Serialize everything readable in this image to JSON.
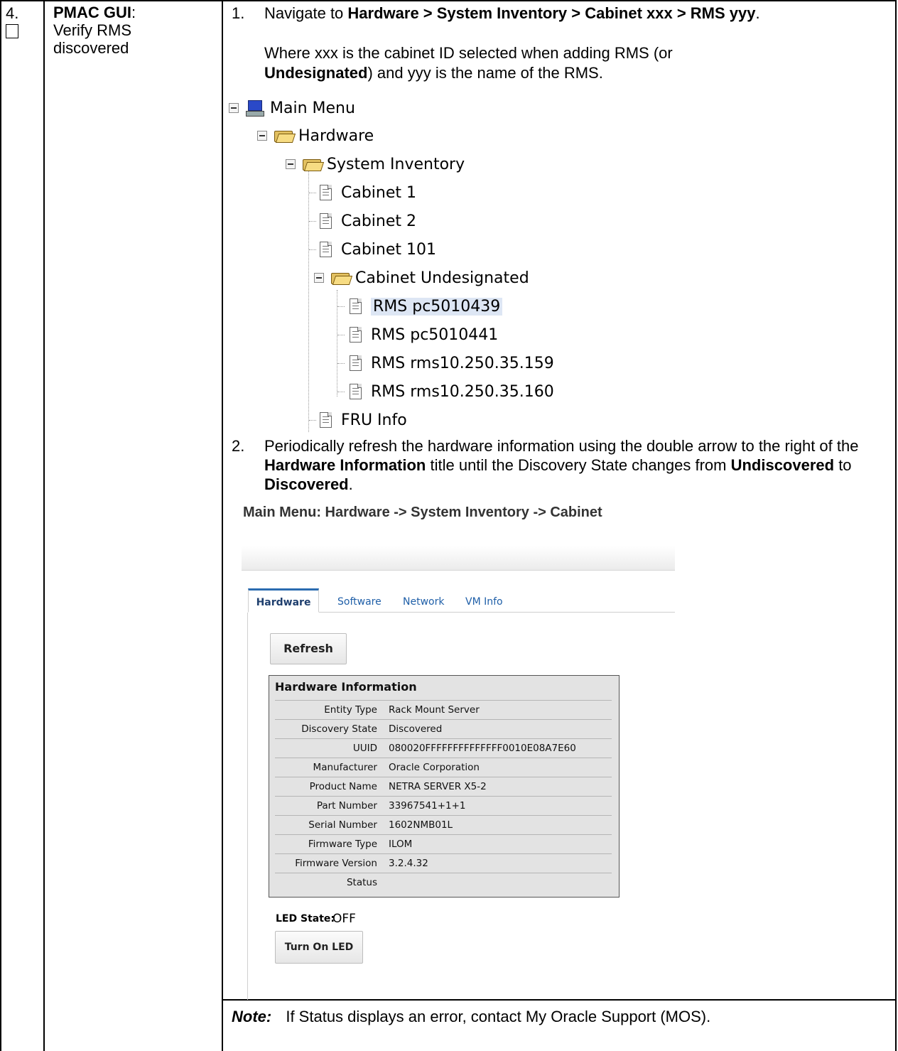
{
  "step": {
    "number": "4.",
    "title_bold": "PMAC GUI",
    "title_colon": ":",
    "title_rest": "Verify RMS discovered"
  },
  "instructions": {
    "item1_num": "1.",
    "item1_prefix": "Navigate to ",
    "item1_path": "Hardware > System Inventory > Cabinet xxx > RMS yyy",
    "item1_suffix": ".",
    "item1b_a": "Where xxx is the cabinet ID selected when adding RMS (or ",
    "item1b_bold": "Undesignated",
    "item1b_b": ") and yyy is the name of the RMS.",
    "item2_num": "2.",
    "item2_a": "Periodically refresh the hardware information using the double arrow to the right of the ",
    "item2_bold1": "Hardware Information",
    "item2_b": " title until the Discovery State changes from ",
    "item2_bold2": "Undiscovered",
    "item2_c": " to ",
    "item2_bold3": "Discovered",
    "item2_d": ".",
    "note_label": "Note:",
    "note_text": "If Status displays an error, contact My Oracle Support (MOS)."
  },
  "tree": {
    "root": "Main Menu",
    "hardware": "Hardware",
    "system_inventory": "System Inventory",
    "cabinets": [
      "Cabinet 1",
      "Cabinet 2",
      "Cabinet 101"
    ],
    "undesignated": "Cabinet Undesignated",
    "rms_items": [
      "RMS pc5010439",
      "RMS pc5010441",
      "RMS rms10.250.35.159",
      "RMS rms10.250.35.160"
    ],
    "fru": "FRU Info"
  },
  "screen": {
    "breadcrumb": "Main Menu: Hardware -> System Inventory -> Cabinet",
    "tabs": [
      "Hardware",
      "Software",
      "Network",
      "VM Info"
    ],
    "refresh_label": "Refresh",
    "hw_title": "Hardware Information",
    "hw_rows": [
      {
        "label": "Entity Type",
        "value": "Rack Mount Server"
      },
      {
        "label": "Discovery State",
        "value": "Discovered"
      },
      {
        "label": "UUID",
        "value": "080020FFFFFFFFFFFFFF0010E08A7E60"
      },
      {
        "label": "Manufacturer",
        "value": "Oracle Corporation"
      },
      {
        "label": "Product Name",
        "value": "NETRA SERVER X5-2"
      },
      {
        "label": "Part Number",
        "value": "33967541+1+1"
      },
      {
        "label": "Serial Number",
        "value": "1602NMB01L"
      },
      {
        "label": "Firmware Type",
        "value": "ILOM"
      },
      {
        "label": "Firmware Version",
        "value": "3.2.4.32"
      },
      {
        "label": "Status",
        "value": ""
      }
    ],
    "led_label": "LED State:",
    "led_value": "OFF",
    "led_button": "Turn On LED"
  }
}
